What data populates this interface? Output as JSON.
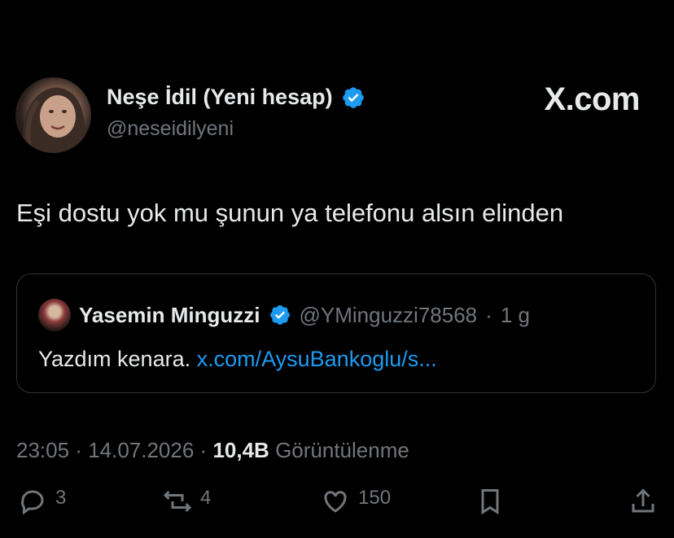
{
  "author": {
    "name": "Neşe İdil (Yeni hesap)",
    "handle": "@neseidilyeni"
  },
  "brand": "X.com",
  "tweet": {
    "text": "Eşi dostu yok mu şunun ya telefonu alsın elinden"
  },
  "quote": {
    "name": "Yasemin Minguzzi",
    "handle": "@YMinguzzi78568",
    "separator": " · ",
    "age": "1 g",
    "text": "Yazdım kenara.",
    "link": "x.com/AysuBankoglu/s..."
  },
  "meta": {
    "time": "23:05",
    "sep1": " · ",
    "date": "14.07.2026",
    "sep2": " · ",
    "views": "10,4B",
    "views_label": "Görüntülenme"
  },
  "actions": {
    "reply_count": "3",
    "repost_count": "4",
    "like_count": "150"
  },
  "colors": {
    "background": "#000000",
    "text": "#e7e9ea",
    "muted": "#71767b",
    "link": "#1d9bf0",
    "verified": "#1d9bf0",
    "border": "#2f3336"
  },
  "icons": [
    "verified-badge-icon",
    "reply-icon",
    "repost-icon",
    "like-icon",
    "bookmark-icon",
    "share-icon"
  ]
}
